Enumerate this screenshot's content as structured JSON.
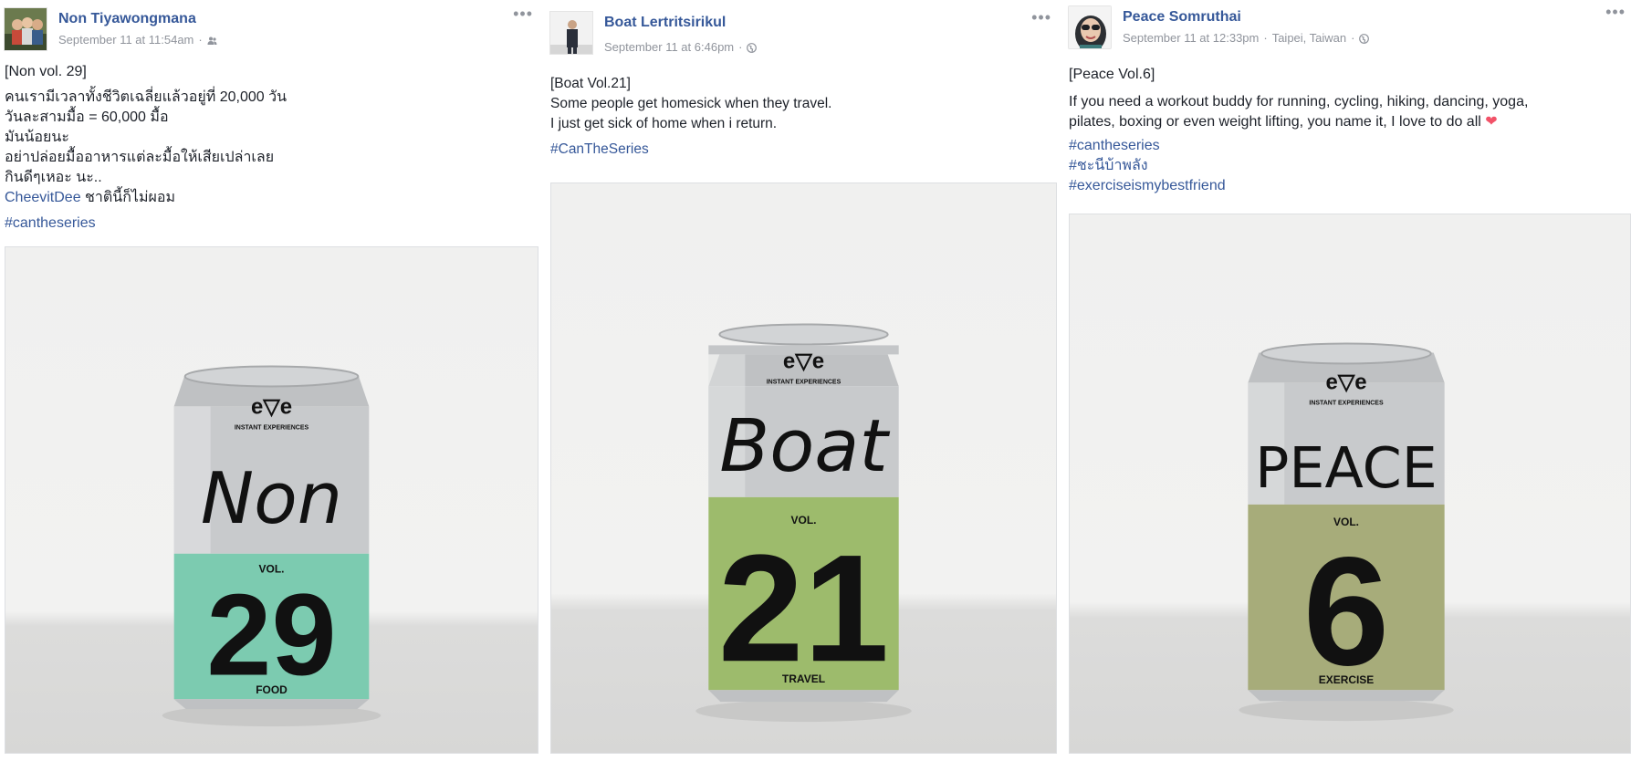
{
  "posts": [
    {
      "author": "Non Tiyawongmana",
      "timestamp": "September 11 at 11:54am",
      "location": "",
      "privacy_icon": "friends-icon",
      "lines": [
        "[Non vol. 29]",
        "คนเรามีเวลาทั้งชีวิตเฉลี่ยแล้วอยู่ที่ 20,000 วัน",
        "วันละสามมื้อ = 60,000 มื้อ",
        "มันน้อยนะ",
        "อย่าปล่อยมื้ออาหารแต่ละมื้อให้เสียเปล่าเลย",
        "กินดีๆเหอะ นะ.."
      ],
      "tag_name": "CheevitDee",
      "tag_suffix": " ชาตินี้ก็ไม่ผอม",
      "hashtags": [
        "#cantheseries"
      ],
      "can": {
        "brand": "e▽e",
        "brand_sub": "INSTANT EXPERIENCES",
        "name": "Non",
        "vol_label": "VOL.",
        "number": "29",
        "category": "FOOD",
        "band_color": "#7ccbb0"
      }
    },
    {
      "author": "Boat Lertritsirikul",
      "timestamp": "September 11 at 6:46pm",
      "location": "",
      "privacy_icon": "globe-icon",
      "lines": [
        "[Boat Vol.21]",
        "Some people get homesick when they travel.",
        "I just get sick of home when i return."
      ],
      "hashtags": [
        "#CanTheSeries"
      ],
      "can": {
        "brand": "e▽e",
        "brand_sub": "INSTANT EXPERIENCES",
        "name": "Boat",
        "vol_label": "VOL.",
        "number": "21",
        "category": "TRAVEL",
        "band_color": "#9dbb6c"
      }
    },
    {
      "author": "Peace Somruthai",
      "timestamp": "September 11 at 12:33pm",
      "location": "Taipei, Taiwan",
      "privacy_icon": "globe-icon",
      "lines": [
        "[Peace Vol.6]",
        "If you need a workout buddy for running, cycling, hiking, dancing, yoga,",
        "pilates, boxing or even weight lifting, you name it, I love to do all"
      ],
      "heart": "❤",
      "hashtags": [
        "#cantheseries",
        "#ชะนีบ้าพลัง",
        "#exerciseismybestfriend"
      ],
      "can": {
        "brand": "e▽e",
        "brand_sub": "INSTANT EXPERIENCES",
        "name": "PEACE",
        "vol_label": "VOL.",
        "number": "6",
        "category": "EXERCISE",
        "band_color": "#a7ac7a"
      }
    }
  ],
  "more_label": "•••",
  "colors": {
    "link": "#365899",
    "meta": "#90949c",
    "heart": "#f25268"
  }
}
